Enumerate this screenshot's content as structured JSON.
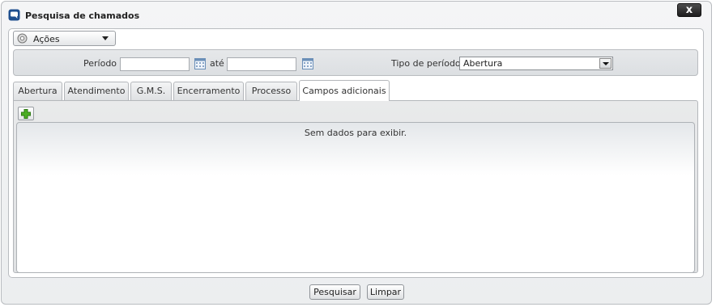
{
  "window": {
    "title": "Pesquisa de chamados",
    "close_label": "x"
  },
  "actions": {
    "label": "Ações",
    "icon": "gear-icon"
  },
  "filters": {
    "period_label": "Período :",
    "period_start_value": "",
    "period_until_label": "até",
    "period_end_value": "",
    "period_type_label": "Tipo de período :",
    "period_type_value": "Abertura"
  },
  "tabs": [
    {
      "label": "Abertura"
    },
    {
      "label": "Atendimento"
    },
    {
      "label": "G.M.S."
    },
    {
      "label": "Encerramento"
    },
    {
      "label": "Processo"
    },
    {
      "label": "Campos adicionais"
    }
  ],
  "active_tab": "Campos adicionais",
  "grid": {
    "empty_message": "Sem dados para exibir."
  },
  "footer": {
    "search_label": "Pesquisar",
    "clear_label": "Limpar"
  },
  "colors": {
    "add_icon": "#3a9a1d",
    "title_icon": "#1f4f8f"
  }
}
